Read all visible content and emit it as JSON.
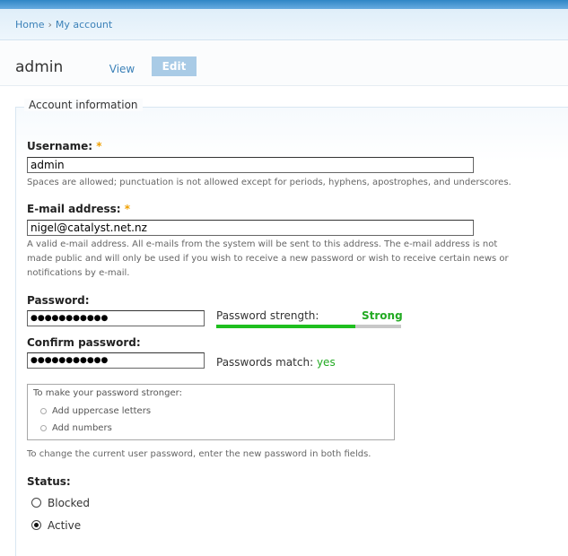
{
  "breadcrumb": {
    "items": [
      "Home",
      "My account"
    ],
    "separator": "›"
  },
  "page": {
    "title": "admin"
  },
  "tabs": {
    "view": "View",
    "edit": "Edit"
  },
  "account": {
    "legend": "Account information",
    "username": {
      "label": "Username:",
      "required": "*",
      "value": "admin",
      "description": "Spaces are allowed; punctuation is not allowed except for periods, hyphens, apostrophes, and underscores."
    },
    "email": {
      "label": "E-mail address:",
      "required": "*",
      "value": "nigel@catalyst.net.nz",
      "description_1": "A valid e-mail address. All e-mails from the system will be sent to this address. The e-mail address is not",
      "description_2": "made public and will only be used if you wish to receive a new password or wish to receive certain news or",
      "description_3": "notifications by e-mail."
    },
    "password": {
      "label": "Password:",
      "value": "●●●●●●●●●●●",
      "strength_label": "Password strength:",
      "strength_value": "Strong",
      "strength_fraction": 0.75
    },
    "confirm": {
      "label": "Confirm password:",
      "value": "●●●●●●●●●●●",
      "match_label": "Passwords match:",
      "match_value": "yes"
    },
    "hints": {
      "title": "To make your password stronger:",
      "items": [
        "Add uppercase letters",
        "Add numbers"
      ]
    },
    "change_note": "To change the current user password, enter the new password in both fields.",
    "status": {
      "label": "Status:",
      "options": [
        "Blocked",
        "Active"
      ],
      "selected": "Active"
    }
  },
  "colors": {
    "accent": "#3b81b8",
    "strong": "#22aa22",
    "required": "#f0a000"
  }
}
